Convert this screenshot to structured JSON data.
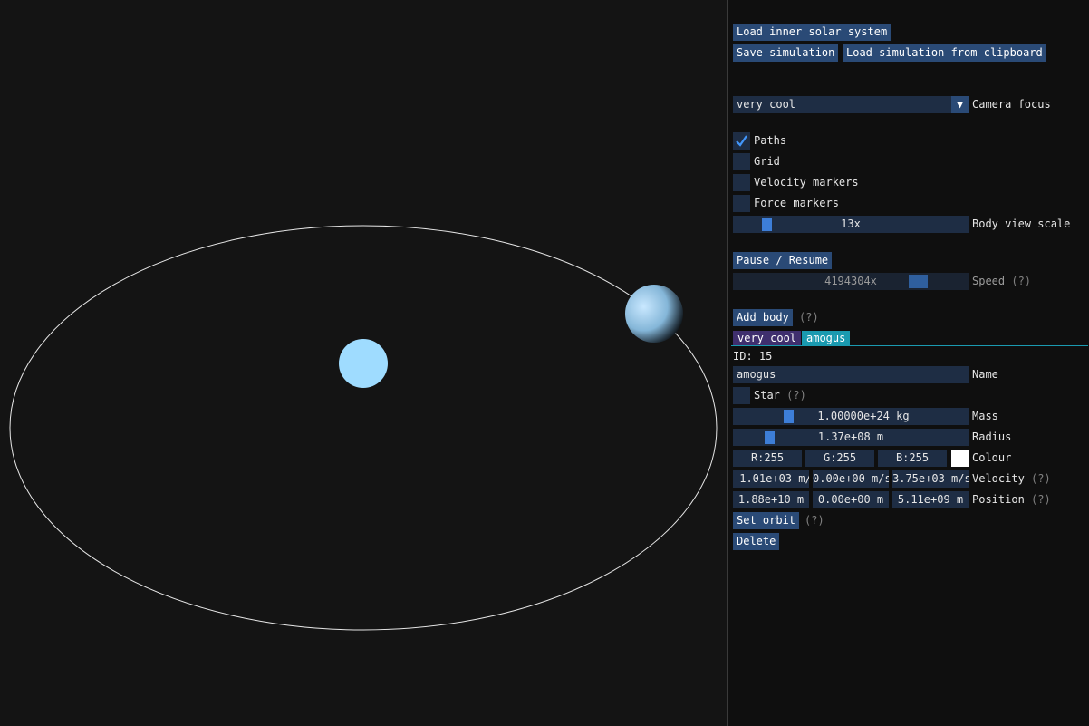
{
  "viewport": {
    "background": "#141414",
    "orbit_path_color": "#e6e6e6",
    "star_color": "#9fdcff",
    "planet_color": "#a8d8ff"
  },
  "panel": {
    "load_inner_solar_system": "Load inner solar system",
    "save_simulation": "Save simulation",
    "load_from_clipboard": "Load simulation from clipboard",
    "camera_focus": {
      "value": "very cool",
      "label": "Camera focus"
    },
    "toggles": [
      {
        "label": "Paths",
        "checked": true
      },
      {
        "label": "Grid",
        "checked": false
      },
      {
        "label": "Velocity markers",
        "checked": false
      },
      {
        "label": "Force markers",
        "checked": false
      }
    ],
    "body_view_scale": {
      "value": "13x",
      "label": "Body view scale"
    },
    "pause_resume": "Pause / Resume",
    "speed": {
      "value": "4194304x",
      "label": "Speed",
      "help": "(?)"
    },
    "add_body": {
      "label": "Add body",
      "help": "(?)"
    },
    "tabs": [
      {
        "label": "very cool",
        "active": false
      },
      {
        "label": "amogus",
        "active": true
      }
    ],
    "body": {
      "id_text": "ID: 15",
      "name_value": "amogus",
      "name_label": "Name",
      "star_label": "Star",
      "star_help": "(?)",
      "mass_value": "1.00000e+24 kg",
      "mass_label": "Mass",
      "radius_value": "1.37e+08 m",
      "radius_label": "Radius",
      "colour_r": "R:255",
      "colour_g": "G:255",
      "colour_b": "B:255",
      "colour_swatch": "#ffffff",
      "colour_label": "Colour",
      "velocity_x": "-1.01e+03 m/",
      "velocity_y": "0.00e+00 m/s",
      "velocity_z": "3.75e+03 m/s",
      "velocity_label": "Velocity",
      "velocity_help": "(?)",
      "position_x": "1.88e+10 m",
      "position_y": "0.00e+00 m",
      "position_z": "5.11e+09 m",
      "position_label": "Position",
      "position_help": "(?)",
      "set_orbit": "Set orbit",
      "set_orbit_help": "(?)",
      "delete": "Delete"
    }
  }
}
